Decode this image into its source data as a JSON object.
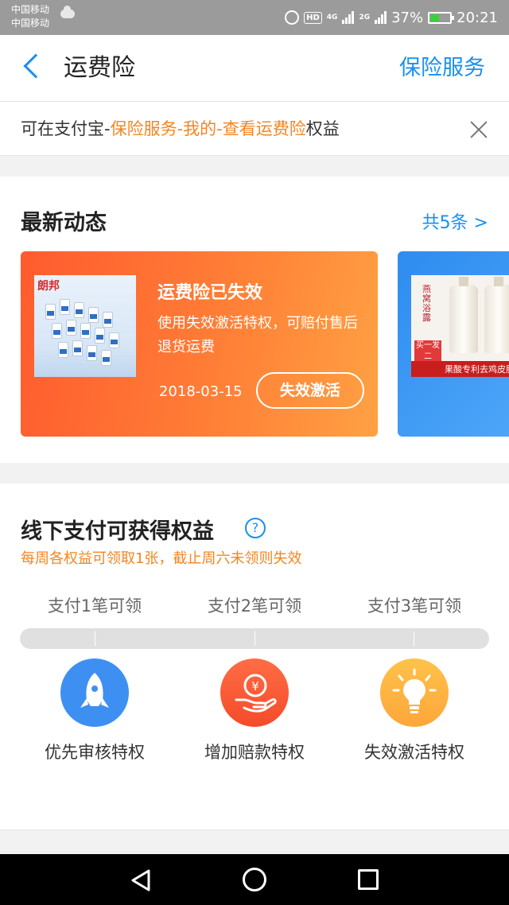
{
  "status_bar": {
    "carrier_1": "中国移动",
    "carrier_2": "中国移动",
    "hd": "HD",
    "net_1": "4G",
    "net_2": "2G",
    "battery": "37%",
    "time": "20:21"
  },
  "navbar": {
    "title": "运费险",
    "action": "保险服务"
  },
  "notice": {
    "prefix": "可在支付宝-",
    "highlight": "保险服务-我的-查看运费险",
    "suffix": "权益"
  },
  "news": {
    "title": "最新动态",
    "more": "共5条 >",
    "card": {
      "thumb_brand": "朗邦",
      "title": "运费险已失效",
      "desc": "使用失效激活特权，可赔付售后退货运费",
      "date": "2018-03-15",
      "button": "失效激活"
    },
    "card2": {
      "band_text": "果酸专利去鸡皮肤",
      "tag": "买一发二",
      "vertical": "燕窝浴露"
    }
  },
  "offline": {
    "title": "线下支付可获得权益",
    "help": "?",
    "subtitle": "每周各权益可领取1张，截止周六未领则失效",
    "steps": [
      "支付1笔可领",
      "支付2笔可领",
      "支付3笔可领"
    ],
    "benefits": [
      "优先审核特权",
      "增加赔款特权",
      "失效激活特权"
    ],
    "benefit_icons": [
      "rocket-icon",
      "yuan-hand-icon",
      "lightbulb-icon"
    ],
    "progress": 0
  },
  "colors": {
    "accent": "#1a8ff0",
    "highlight": "#f5851f",
    "card_gradient_start": "#ff5b2e",
    "card_gradient_end": "#ffa143"
  }
}
